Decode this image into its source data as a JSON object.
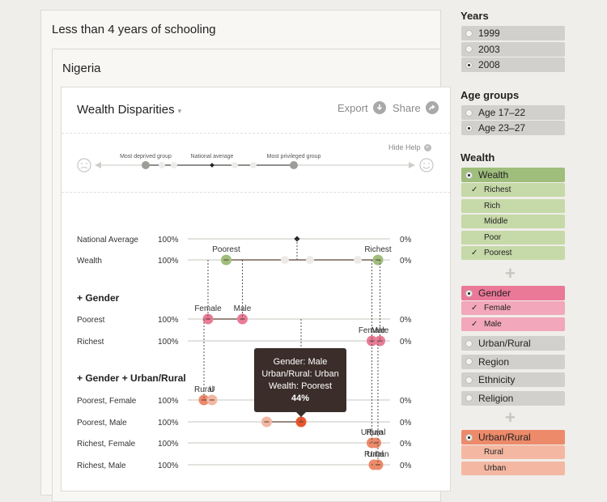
{
  "breadcrumb": {
    "level1": "Less than 4 years of schooling",
    "level2": "Nigeria"
  },
  "card": {
    "title": "Wealth Disparities",
    "caret": "▾",
    "export_label": "Export",
    "share_label": "Share",
    "export_icon": "download-icon",
    "share_icon": "share-arrow-icon",
    "help": {
      "hide_label": "Hide Help",
      "most_deprived": "Most deprived group",
      "national_average": "National average",
      "most_privileged": "Most privileged group",
      "left_icon": "sad-face-icon",
      "right_icon": "happy-face-icon"
    }
  },
  "chart_data": {
    "type": "dot-range",
    "axis_left_label": "100%",
    "axis_right_label": "0%",
    "xlim": [
      100,
      0
    ],
    "national_average": 46,
    "rows": [
      {
        "label": "National Average",
        "points": [
          {
            "value": 46,
            "color": "#222222",
            "label": ""
          }
        ]
      },
      {
        "label": "Wealth",
        "points": [
          {
            "value": 81,
            "color": "#9fbe7c",
            "label": "Poorest"
          },
          {
            "value": 6,
            "color": "#9fbe7c",
            "label": "Richest"
          }
        ]
      },
      {
        "section": "+ Gender"
      },
      {
        "label": "Poorest",
        "points": [
          {
            "value": 90,
            "color": "#e97b96",
            "label": "Female"
          },
          {
            "value": 73,
            "color": "#e97b96",
            "label": "Male"
          }
        ]
      },
      {
        "label": "Richest",
        "points": [
          {
            "value": 9,
            "color": "#e97b96",
            "label": "Female"
          },
          {
            "value": 5,
            "color": "#e97b96",
            "label": "Male"
          }
        ]
      },
      {
        "section": "+ Gender + Urban/Rural"
      },
      {
        "label": "Poorest, Female",
        "points": [
          {
            "value": 92,
            "color": "#ec8a6a",
            "label": "Rural"
          },
          {
            "value": 88,
            "color": "#f2b7a3",
            "label": "U"
          }
        ]
      },
      {
        "label": "Poorest, Male",
        "points": [
          {
            "value": 61,
            "color": "#f2b7a3",
            "label": ""
          },
          {
            "value": 44,
            "color": "#e8562e",
            "label": ""
          }
        ]
      },
      {
        "label": "Richest, Female",
        "points": [
          {
            "value": 9,
            "color": "#ec8a6a",
            "label": "Urban"
          },
          {
            "value": 7,
            "color": "#ec8a6a",
            "label": "Rural"
          }
        ]
      },
      {
        "label": "Richest, Male",
        "points": [
          {
            "value": 8,
            "color": "#ec8a6a",
            "label": "Rural"
          },
          {
            "value": 6,
            "color": "#ec8a6a",
            "label": "Urban"
          }
        ]
      }
    ]
  },
  "tooltip": {
    "line1": "Gender: Male",
    "line2": "Urban/Rural: Urban",
    "line3": "Wealth: Poorest",
    "value": "44%"
  },
  "sidebar": {
    "years": {
      "heading": "Years",
      "options": [
        {
          "label": "1999",
          "selected": false
        },
        {
          "label": "2003",
          "selected": false
        },
        {
          "label": "2008",
          "selected": true
        }
      ]
    },
    "age_groups": {
      "heading": "Age groups",
      "options": [
        {
          "label": "Age 17–22",
          "selected": false
        },
        {
          "label": "Age 23–27",
          "selected": true
        }
      ]
    },
    "wealth": {
      "heading": "Wealth",
      "main": "Wealth",
      "color_main": "#9fbe7c",
      "color_sub": "#c6d9a8",
      "sub": [
        {
          "label": "Richest",
          "checked": true
        },
        {
          "label": "Rich",
          "checked": false
        },
        {
          "label": "Middle",
          "checked": false
        },
        {
          "label": "Poor",
          "checked": false
        },
        {
          "label": "Poorest",
          "checked": true
        }
      ]
    },
    "gender": {
      "main": "Gender",
      "color_main": "#ea7897",
      "color_sub": "#f2a7ba",
      "sub": [
        {
          "label": "Female",
          "checked": true
        },
        {
          "label": "Male",
          "checked": true
        }
      ]
    },
    "others": [
      "Urban/Rural",
      "Region",
      "Ethnicity",
      "Religion"
    ],
    "urban_rural": {
      "main": "Urban/Rural",
      "color_main": "#ec8a6a",
      "color_sub": "#f4b8a2",
      "sub": [
        {
          "label": "Rural"
        },
        {
          "label": "Urban"
        }
      ]
    },
    "plus": "+"
  }
}
